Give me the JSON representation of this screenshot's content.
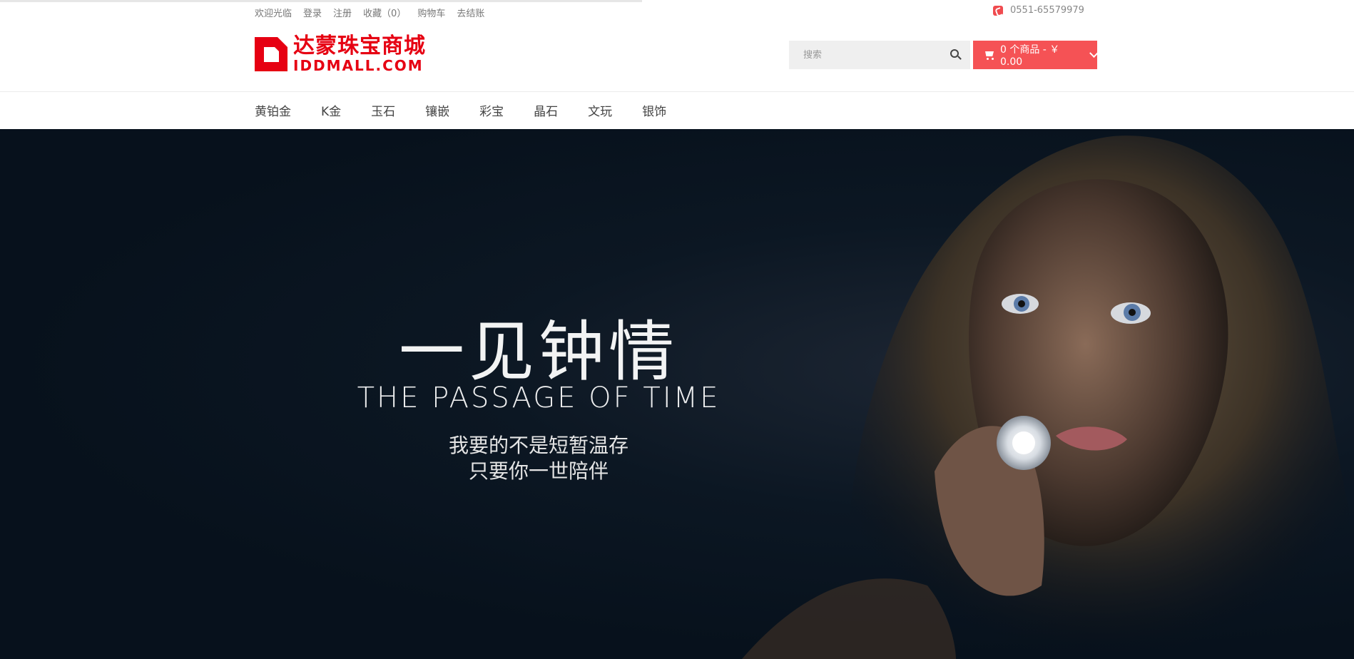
{
  "topbar": {
    "links": [
      "欢迎光临",
      "登录",
      "注册",
      "收藏（0）",
      "购物车",
      "去结账"
    ],
    "phone": "0551-65579979"
  },
  "header": {
    "logo_cn": "达蒙珠宝商城",
    "logo_en": "IDDMALL.COM",
    "search_placeholder": "搜索",
    "cart_label": "0 个商品 - ￥ 0.00"
  },
  "nav": {
    "items": [
      "黄铂金",
      "K金",
      "玉石",
      "镶嵌",
      "彩宝",
      "晶石",
      "文玩",
      "银饰"
    ]
  },
  "hero": {
    "title_cn": "一见钟情",
    "title_en": "THE PASSAGE OF TIME",
    "line1": "我要的不是短暂温存",
    "line2": "只要你一世陪伴"
  },
  "colors": {
    "brand": "#e60012",
    "cart_bg": "#f55255",
    "hero_bg": "#0c1723"
  },
  "icons": [
    "phone-icon",
    "search-icon",
    "cart-icon",
    "chevron-down-icon"
  ]
}
